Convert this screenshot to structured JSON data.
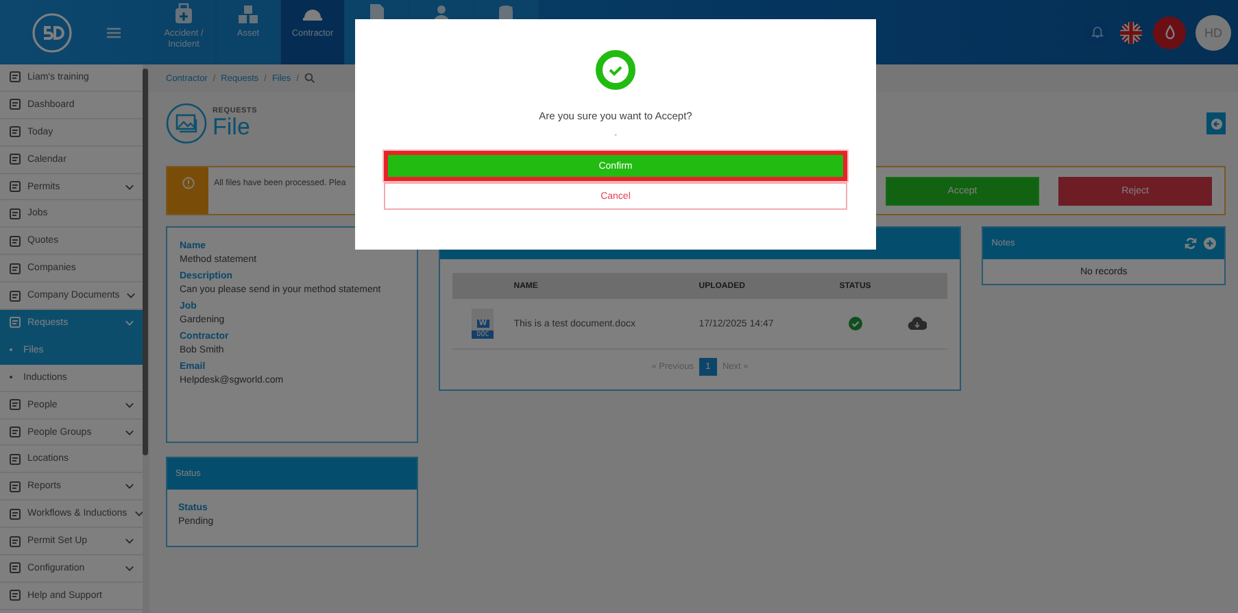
{
  "top_nav": {
    "tiles": [
      {
        "kind": "first-aid",
        "label": "Accident / Incident",
        "selected": false
      },
      {
        "kind": "boxes",
        "label": "Asset",
        "selected": false
      },
      {
        "kind": "hardhat",
        "label": "Contractor",
        "selected": true
      },
      {
        "kind": "document",
        "selected": false
      },
      {
        "kind": "person",
        "selected": false
      },
      {
        "kind": "stack",
        "selected": false
      }
    ],
    "avatar": "HD"
  },
  "sidebar": {
    "items": [
      {
        "label": "Liam's training",
        "has_dropdown": false,
        "selected": false
      },
      {
        "label": "Dashboard",
        "has_dropdown": false,
        "selected": false
      },
      {
        "label": "Today",
        "has_dropdown": false,
        "selected": false
      },
      {
        "label": "Calendar",
        "has_dropdown": false,
        "selected": false
      },
      {
        "label": "Permits",
        "has_dropdown": true,
        "selected": false
      },
      {
        "label": "Jobs",
        "has_dropdown": false,
        "selected": false
      },
      {
        "label": "Quotes",
        "has_dropdown": false,
        "selected": false
      },
      {
        "label": "Companies",
        "has_dropdown": false,
        "selected": false
      },
      {
        "label": "Company Documents",
        "has_dropdown": true,
        "selected": false
      },
      {
        "label": "Requests",
        "has_dropdown": true,
        "selected": true,
        "children": [
          {
            "label": "Files",
            "selected": true
          },
          {
            "label": "Inductions",
            "selected": false
          }
        ]
      },
      {
        "label": "People",
        "has_dropdown": true,
        "selected": false
      },
      {
        "label": "People Groups",
        "has_dropdown": true,
        "selected": false
      },
      {
        "label": "Locations",
        "has_dropdown": false,
        "selected": false
      },
      {
        "label": "Reports",
        "has_dropdown": true,
        "selected": false
      },
      {
        "label": "Workflows & Inductions",
        "has_dropdown": true,
        "selected": false
      },
      {
        "label": "Permit Set Up",
        "has_dropdown": true,
        "selected": false
      },
      {
        "label": "Configuration",
        "has_dropdown": true,
        "selected": false
      },
      {
        "label": "Help and Support",
        "has_dropdown": false,
        "selected": false
      }
    ]
  },
  "breadcrumb": [
    {
      "label": "Contractor",
      "separator": "/"
    },
    {
      "label": "Requests",
      "separator": "/"
    },
    {
      "label": "Files",
      "separator": "/"
    }
  ],
  "heading": {
    "section": "REQUESTS",
    "title": "File"
  },
  "alert": {
    "text": "All files have been processed. Plea",
    "buttons": [
      "Accept",
      "Reject"
    ]
  },
  "details": {
    "fields": [
      {
        "label": "Name",
        "value": "Method statement"
      },
      {
        "label": "Description",
        "value": "Can you please send in your method statement"
      },
      {
        "label": "Job",
        "value": "Gardening"
      },
      {
        "label": "Contractor",
        "value": "Bob Smith"
      },
      {
        "label": "Email",
        "value": "Helpdesk@sgworld.com"
      }
    ]
  },
  "status_card": {
    "title": "Status",
    "fields": [
      {
        "label": "Status",
        "value": "Pending"
      }
    ]
  },
  "files_table": {
    "columns": [
      "NAME",
      "UPLOADED",
      "STATUS"
    ],
    "rows": [
      {
        "name": "This is a test document.docx",
        "uploaded": "17/12/2025 14:47",
        "file_type": "DOC",
        "app_letter": "W",
        "complete": true
      }
    ],
    "pagination": {
      "previous": "« Previous",
      "pages": [
        {
          "label": "1",
          "selected": true
        }
      ],
      "next": "Next »"
    }
  },
  "notes": {
    "title": "Notes",
    "empty": "No records"
  },
  "modal": {
    "message": "Are you sure you want to Accept?",
    "detail": "-",
    "confirm": {
      "label": "Confirm",
      "focused": true
    },
    "cancel": "Cancel"
  }
}
